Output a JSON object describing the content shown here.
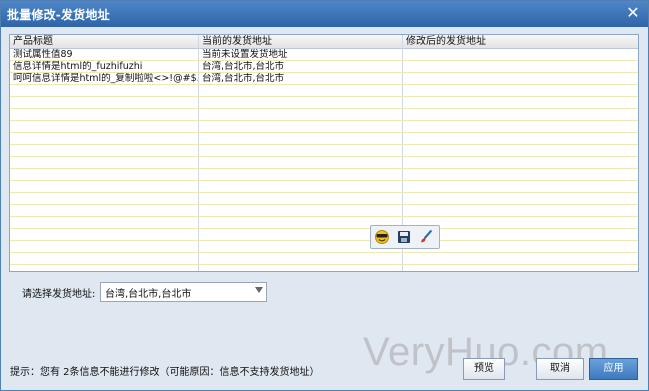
{
  "dialog": {
    "title": "批量修改-发货地址",
    "close_glyph": "✕"
  },
  "grid": {
    "columns": [
      "产品标题",
      "当前的发货地址",
      "修改后的发货地址"
    ],
    "rows": [
      {
        "title": "测试属性值89",
        "current": "当前未设置发货地址",
        "new": ""
      },
      {
        "title": "信息详情是html的_fuzhifuzhi",
        "current": "台湾,台北市,台北市",
        "new": ""
      },
      {
        "title": "呵呵信息详情是html的_复制啦啦<>!@#$...",
        "current": "台湾,台北市,台北市",
        "new": ""
      }
    ],
    "empty_rows": 20
  },
  "floating_toolbar": {
    "icons": [
      "smiley-icon",
      "save-icon",
      "brush-icon"
    ]
  },
  "address_select": {
    "label": "请选择发货地址:",
    "value": "台湾,台北市,台北市"
  },
  "footer": {
    "hint": "提示：您有 2条信息不能进行修改（可能原因：信息不支持发货地址）",
    "buttons": {
      "preview": "预览",
      "cancel": "取消",
      "apply": "应用"
    }
  },
  "watermark": "VeryHuo.com"
}
